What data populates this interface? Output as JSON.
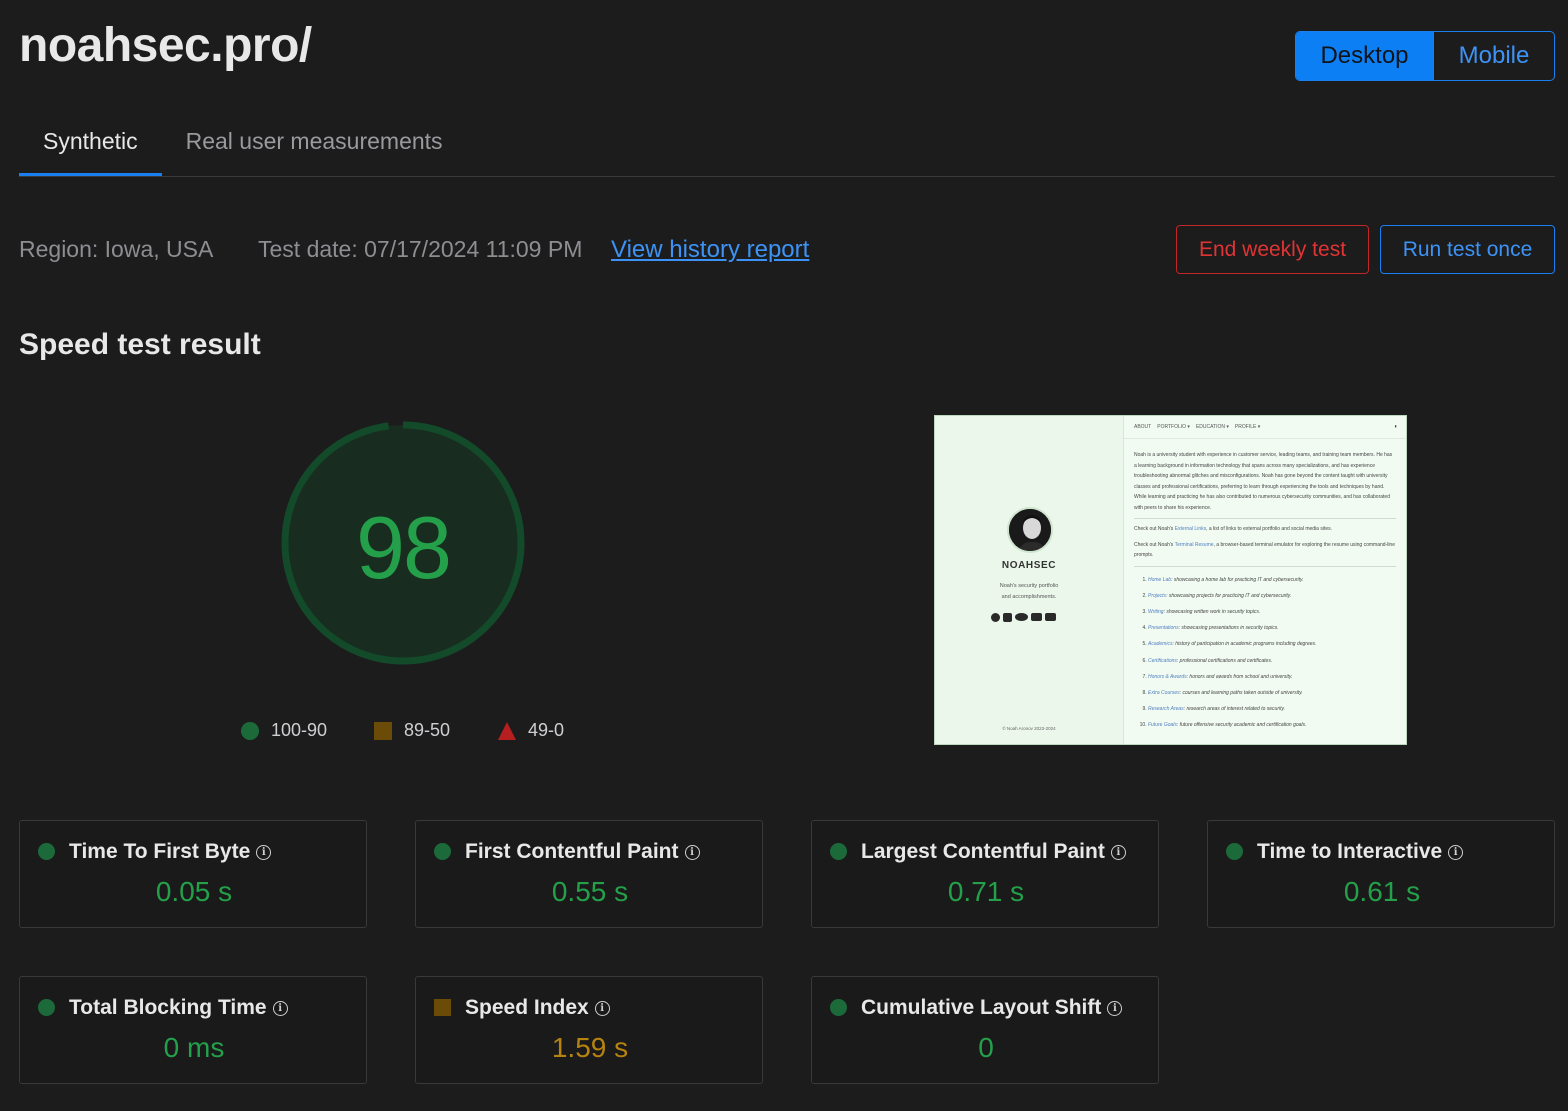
{
  "header": {
    "site_title": "noahsec.pro/",
    "device_toggle": {
      "desktop": "Desktop",
      "mobile": "Mobile",
      "selected": "Desktop"
    }
  },
  "tabs": [
    {
      "label": "Synthetic",
      "active": true
    },
    {
      "label": "Real user measurements",
      "active": false
    }
  ],
  "test_info": {
    "region": "Region: Iowa, USA",
    "test_date": "Test date: 07/17/2024 11:09 PM",
    "history_link": "View history report",
    "end_button": "End weekly test",
    "run_button": "Run test once"
  },
  "result": {
    "title": "Speed test result",
    "score": "98",
    "score_fraction": 0.98,
    "legend": [
      {
        "shape": "circle",
        "label": "100-90",
        "color": "#1c6a3a"
      },
      {
        "shape": "square",
        "label": "89-50",
        "color": "#6b4b08"
      },
      {
        "shape": "triangle",
        "label": "49-0",
        "color": "#b51f1f"
      }
    ]
  },
  "preview": {
    "nav": [
      "ABOUT",
      "PORTFOLIO ▾",
      "EDUCATION ▾",
      "PROFILE ▾"
    ],
    "name": "NOAHSEC",
    "tagline": "Noah's security portfolio and accomplishments.",
    "footer": "© Noah Aronov 2023-2024",
    "intro": "Noah is a university student with experience in customer service, leading teams, and training team members. He has a learning background in information technology that spans across many specializations, and has experience troubleshooting abnormal glitches and misconfigurations. Noah has gone beyond the content taught with university classes and professional certifications, preferring to learn through experiencing the tools and techniques by hand. While learning and practicing he has also contributed to numerous cybersecurity communities, and has collaborated with peers to share his experience.",
    "line1_pre": "Check out Noah's ",
    "line1_link": "External Links",
    "line1_post": ", a list of links to external portfolio and social media sites.",
    "line2_pre": "Check out Noah's ",
    "line2_link": "Terminal Resume",
    "line2_post": ", a browser-based terminal emulator for exploring the resume using command-line prompts.",
    "list": [
      {
        "link": "Home Lab",
        "text": ": showcasing a home lab for practicing IT and cybersecurity."
      },
      {
        "link": "Projects",
        "text": ": showcasing projects for practicing IT and cybersecurity."
      },
      {
        "link": "Writing",
        "text": ": showcasing written work in security topics."
      },
      {
        "link": "Presentations",
        "text": ": showcasing presentations in security topics."
      },
      {
        "link": "Academics",
        "text": ": history of participation in academic programs including degrees."
      },
      {
        "link": "Certifications",
        "text": ": professional certifications and certificates."
      },
      {
        "link": "Honors & Awards",
        "text": ": honors and awards from school and university."
      },
      {
        "link": "Extra Courses",
        "text": ": courses and learning paths taken outside of university."
      },
      {
        "link": "Research Areas",
        "text": ": research areas of interest related to security."
      },
      {
        "link": "Future Goals",
        "text": ": future offensive security academic and certification goals."
      }
    ]
  },
  "metrics": [
    {
      "label": "Time To First Byte",
      "value": "0.05 s",
      "status": "good"
    },
    {
      "label": "First Contentful Paint",
      "value": "0.55 s",
      "status": "good"
    },
    {
      "label": "Largest Contentful Paint",
      "value": "0.71 s",
      "status": "good"
    },
    {
      "label": "Time to Interactive",
      "value": "0.61 s",
      "status": "good"
    },
    {
      "label": "Total Blocking Time",
      "value": "0 ms",
      "status": "good"
    },
    {
      "label": "Speed Index",
      "value": "1.59 s",
      "status": "average"
    },
    {
      "label": "Cumulative Layout Shift",
      "value": "0",
      "status": "good"
    }
  ],
  "icons": {
    "info": "info-icon",
    "status_good": "green-circle",
    "status_average": "amber-square",
    "status_poor": "red-triangle"
  },
  "colors": {
    "background": "#1c1c1d",
    "accent": "#1a7ff0",
    "good": "#24a04a",
    "average": "#b7830f",
    "poor": "#b51f1f",
    "danger": "#e03434"
  }
}
